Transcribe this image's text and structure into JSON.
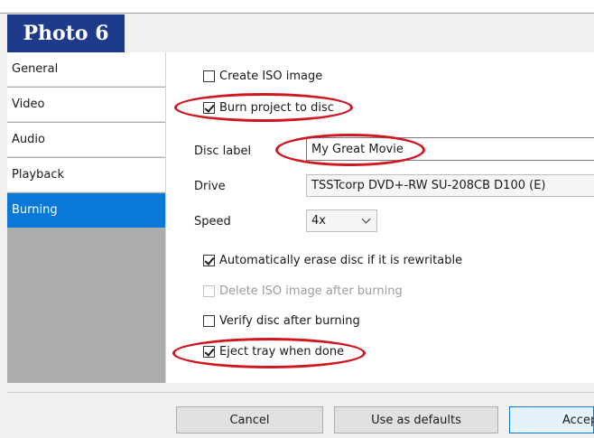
{
  "photo_label": "Photo 6",
  "sidebar": {
    "items": [
      {
        "label": "General",
        "active": false
      },
      {
        "label": "Video",
        "active": false
      },
      {
        "label": "Audio",
        "active": false
      },
      {
        "label": "Playback",
        "active": false
      },
      {
        "label": "Burning",
        "active": true
      }
    ]
  },
  "burning": {
    "create_iso": {
      "label": "Create ISO image",
      "checked": false
    },
    "burn_project": {
      "label": "Burn project to disc",
      "checked": true
    },
    "disc_label": {
      "label": "Disc label",
      "value": "My Great Movie"
    },
    "drive": {
      "label": "Drive",
      "value": "TSSTcorp DVD+-RW SU-208CB D100 (E)"
    },
    "speed": {
      "label": "Speed",
      "value": "4x"
    },
    "auto_erase": {
      "label": "Automatically erase disc if it is rewritable",
      "checked": true
    },
    "delete_iso": {
      "label": "Delete ISO image after burning",
      "checked": false,
      "disabled": true
    },
    "verify": {
      "label": "Verify disc after burning",
      "checked": false
    },
    "eject": {
      "label": "Eject tray when done",
      "checked": true
    }
  },
  "buttons": {
    "cancel": "Cancel",
    "defaults": "Use as defaults",
    "accept": "Accep"
  },
  "colors": {
    "accent": "#0a78d7",
    "photo_label_bg": "#1e3a8a",
    "annotation": "#d0161f"
  }
}
